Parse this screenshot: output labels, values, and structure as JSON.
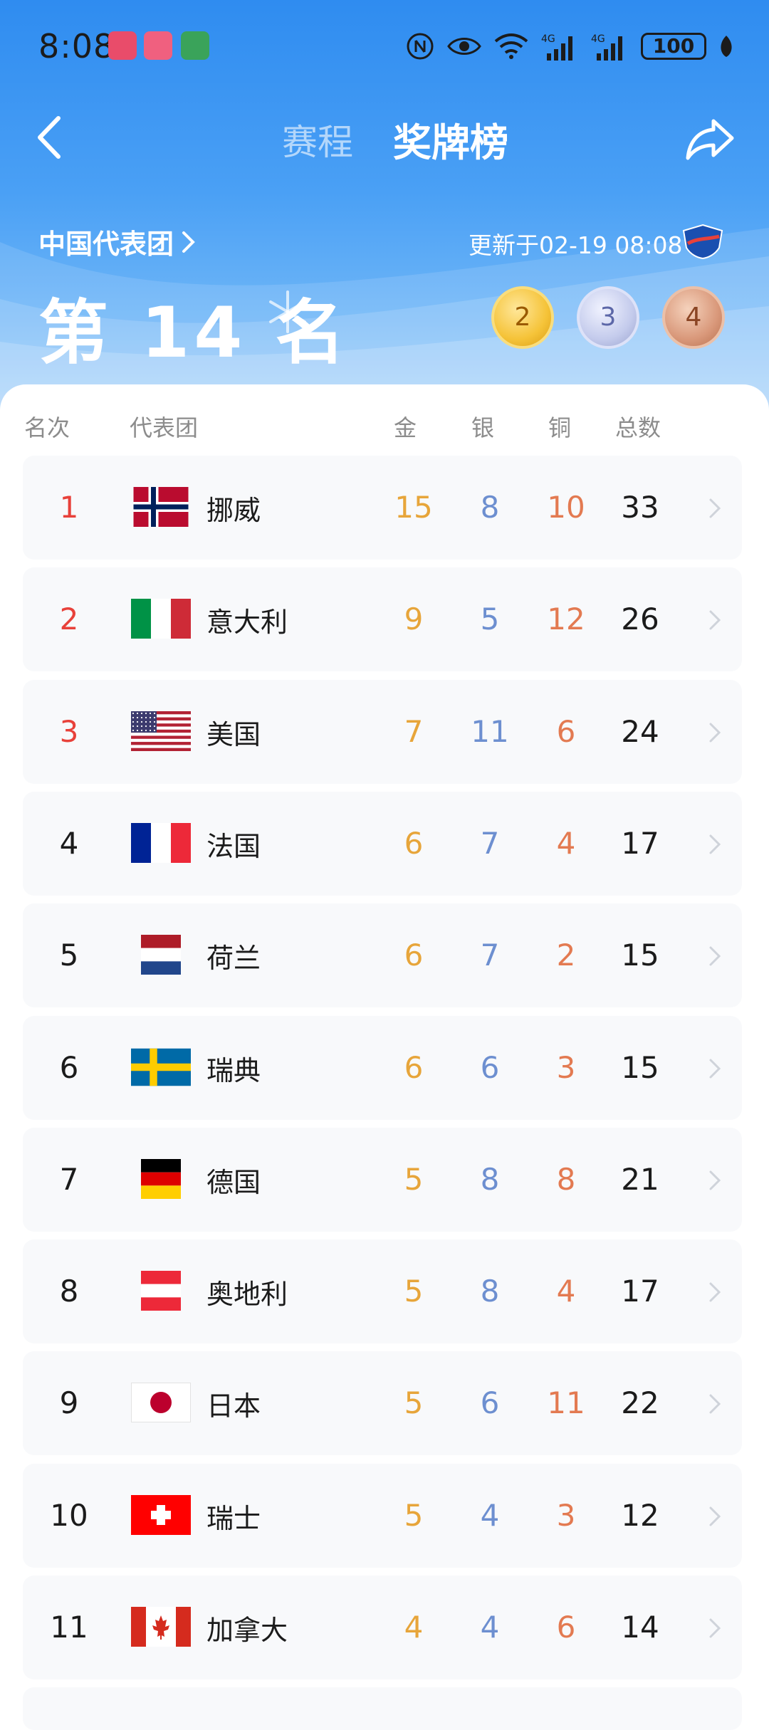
{
  "status_bar": {
    "time": "8:08",
    "battery": "100"
  },
  "nav": {
    "tab_schedule": "赛程",
    "tab_medals": "奖牌榜"
  },
  "delegation": {
    "name": "中国代表团",
    "update_time": "更新于02-19 08:08",
    "rank_text": "第 14 名",
    "gold": "2",
    "silver": "3",
    "bronze": "4"
  },
  "table": {
    "headers": {
      "rank": "名次",
      "team": "代表团",
      "gold": "金",
      "silver": "银",
      "bronze": "铜",
      "total": "总数"
    },
    "rows": [
      {
        "rank": "1",
        "team": "挪威",
        "flag": "norway-flag",
        "gold": "15",
        "silver": "8",
        "bronze": "10",
        "total": "33"
      },
      {
        "rank": "2",
        "team": "意大利",
        "flag": "italy-flag",
        "gold": "9",
        "silver": "5",
        "bronze": "12",
        "total": "26"
      },
      {
        "rank": "3",
        "team": "美国",
        "flag": "usa-flag",
        "gold": "7",
        "silver": "11",
        "bronze": "6",
        "total": "24"
      },
      {
        "rank": "4",
        "team": "法国",
        "flag": "france-flag",
        "gold": "6",
        "silver": "7",
        "bronze": "4",
        "total": "17"
      },
      {
        "rank": "5",
        "team": "荷兰",
        "flag": "netherlands-flag",
        "gold": "6",
        "silver": "7",
        "bronze": "2",
        "total": "15"
      },
      {
        "rank": "6",
        "team": "瑞典",
        "flag": "sweden-flag",
        "gold": "6",
        "silver": "6",
        "bronze": "3",
        "total": "15"
      },
      {
        "rank": "7",
        "team": "德国",
        "flag": "germany-flag",
        "gold": "5",
        "silver": "8",
        "bronze": "8",
        "total": "21"
      },
      {
        "rank": "8",
        "team": "奥地利",
        "flag": "austria-flag",
        "gold": "5",
        "silver": "8",
        "bronze": "4",
        "total": "17"
      },
      {
        "rank": "9",
        "team": "日本",
        "flag": "japan-flag",
        "gold": "5",
        "silver": "6",
        "bronze": "11",
        "total": "22"
      },
      {
        "rank": "10",
        "team": "瑞士",
        "flag": "switzerland-flag",
        "gold": "5",
        "silver": "4",
        "bronze": "3",
        "total": "12"
      },
      {
        "rank": "11",
        "team": "加拿大",
        "flag": "canada-flag",
        "gold": "4",
        "silver": "4",
        "bronze": "6",
        "total": "14"
      }
    ]
  },
  "colors": {
    "gold_text": "#e7a53a",
    "silver_text": "#6d8fd0",
    "bronze_text": "#e37a51",
    "top_rank": "#e8413a",
    "header_blue": "#2f8cf0"
  },
  "icons": {
    "back": "back-arrow-icon",
    "share": "share-icon",
    "chevron": "chevron-right-icon"
  }
}
